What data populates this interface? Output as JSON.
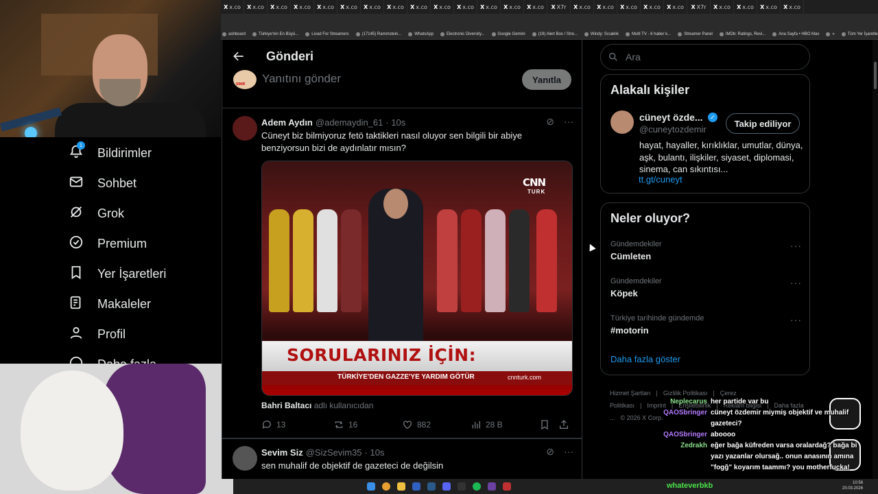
{
  "browser": {
    "tabs": [
      "x.co",
      "x.co",
      "x.co",
      "x.co",
      "x.co",
      "x.co",
      "x.co",
      "x.co",
      "x.co",
      "x.co",
      "x.co",
      "x.co",
      "x.co",
      "x.co",
      "X7r",
      "x.co",
      "x.co",
      "x.co",
      "x.co",
      "x.co",
      "X7r",
      "x.co",
      "x.co",
      "x.co",
      "x.co"
    ],
    "bookmarks": [
      "ashboard",
      "Türkiye'nin En Büyü...",
      "Livad For Streamers",
      "(17145) Rammstein...",
      "WhatsApp",
      "Electronic Diversity...",
      "Google Gemini",
      "(19) Alert Box / Stre...",
      "Windy: Sıcaklık",
      "Multi TV - 6 haber k...",
      "Streamer Panel",
      "IMDb: Ratings, Revi...",
      "Ana Sayfa • HBO Max",
      "»",
      "Tüm Yer İşaretleri"
    ]
  },
  "nav": {
    "items": [
      {
        "label": "Bildirimler",
        "icon": "bell-icon",
        "badge": "1"
      },
      {
        "label": "Sohbet",
        "icon": "mail-icon"
      },
      {
        "label": "Grok",
        "icon": "grok-icon"
      },
      {
        "label": "Premium",
        "icon": "verified-icon"
      },
      {
        "label": "Yer İşaretleri",
        "icon": "bookmark-icon"
      },
      {
        "label": "Makaleler",
        "icon": "article-icon"
      },
      {
        "label": "Profil",
        "icon": "person-icon"
      },
      {
        "label": "Daha fazla",
        "icon": "more-circle-icon"
      }
    ]
  },
  "main": {
    "title": "Gönderi",
    "reply_placeholder": "Yanıtını gönder",
    "reply_button": "Yanıtla",
    "reply_avatar_text": "SINIR"
  },
  "tweets": [
    {
      "name": "Adem Aydın",
      "handle": "@ademaydin_61",
      "time": "· 10s",
      "text": "Cüneyt biz bilmiyoruz fetö taktikleri nasıl oluyor sen bilgili bir abiye benziyorsun bizi de aydınlatır mısın?",
      "video": {
        "logo": "CNN",
        "logo_sub": "TURK",
        "banner": "SORULARINIZ İÇİN:",
        "ticker": "TÜRKİYE'DEN GAZZE'YE YARDIM GÖTÜR",
        "url": "cnnturk.com"
      },
      "repost_user": "Bahri Baltacı",
      "repost_suffix": "adlı kullanıcıdan",
      "replies": "13",
      "reposts": "16",
      "likes": "882",
      "views": "28 B"
    },
    {
      "name": "Sevim Siz",
      "handle": "@SizSevim35",
      "time": "· 10s",
      "text": "sen muhalif de objektif de gazeteci de değilsin"
    }
  ],
  "right": {
    "search_placeholder": "Ara",
    "related_title": "Alakalı kişiler",
    "person": {
      "name": "cüneyt özde...",
      "handle": "@cuneytozdemir",
      "follow_label": "Takip ediliyor",
      "bio": "hayat, hayaller, kırıklıklar, umutlar, dünya, aşk, bulantı, ilişkiler, siyaset, diplomasi, sinema, can sıkıntısı...",
      "link": "tt.gt/cuneyt"
    },
    "trends_title": "Neler oluyor?",
    "trends": [
      {
        "category": "Gündemdekiler",
        "name": "Cümleten"
      },
      {
        "category": "Gündemdekiler",
        "name": "Köpek"
      },
      {
        "category": "Türkiye tarihinde gündemde",
        "name": "#motorin"
      }
    ],
    "show_more": "Daha fazla göster",
    "footer": [
      "Hizmet Şartları",
      "|",
      "Gizlilik Politikası",
      "|",
      "Çerez Politikası",
      "|",
      "Imprint",
      "|",
      "Erişilebilirlik",
      "|",
      "Reklam bilgisi",
      "|",
      "Daha fazla ...",
      "© 2026 X Corp."
    ]
  },
  "chat": [
    {
      "user": "Neplecarus",
      "color": "#8be08b",
      "text": "her partide var bu"
    },
    {
      "user": "QAOSbringer",
      "color": "#b57bff",
      "text": "cüneyt özdemir miymiş objektif ve muhalif gazeteci?"
    },
    {
      "user": "QAOSbringer",
      "color": "#b57bff",
      "text": "aboooo"
    },
    {
      "user": "Zedrakh",
      "color": "#8be08b",
      "text": "eğer bağa küfreden varsa oralardağ? bağa bi yazı yazanlar olursağ.. onun anasının amına \"fogğ\" koyarım taammı? you motherfucka!"
    }
  ],
  "taskbar": {
    "user": "whateverbkb",
    "time": "10:56",
    "date": "20.03.2026"
  }
}
